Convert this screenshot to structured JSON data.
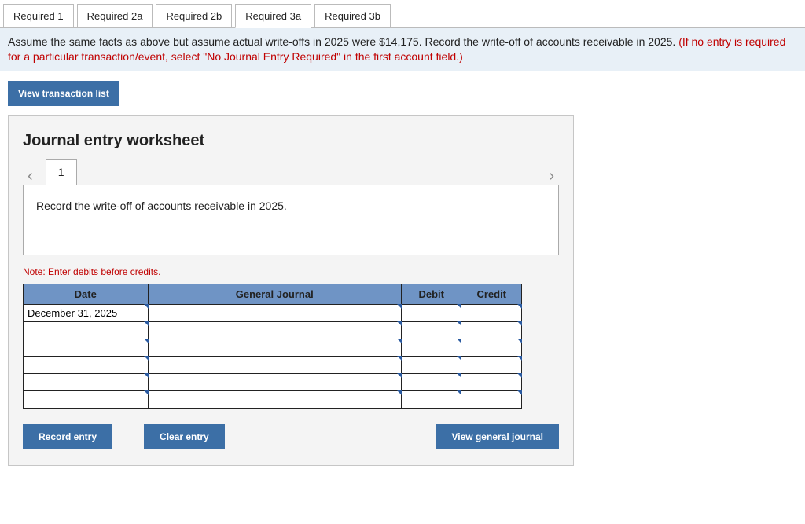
{
  "tabs": {
    "items": [
      {
        "label": "Required 1"
      },
      {
        "label": "Required 2a"
      },
      {
        "label": "Required 2b"
      },
      {
        "label": "Required 3a"
      },
      {
        "label": "Required 3b"
      }
    ],
    "activeIndex": 3
  },
  "instruction": {
    "main": "Assume the same facts as above but assume actual write-offs in 2025 were $14,175. Record the write-off of accounts receivable in 2025. ",
    "hint": "(If no entry is required for a particular transaction/event, select \"No Journal Entry Required\" in the first account field.)"
  },
  "buttons": {
    "view_transactions": "View transaction list",
    "record_entry": "Record entry",
    "clear_entry": "Clear entry",
    "view_general_journal": "View general journal"
  },
  "worksheet": {
    "title": "Journal entry worksheet",
    "page_number": "1",
    "prompt": "Record the write-off of accounts receivable in 2025.",
    "note": "Note: Enter debits before credits.",
    "headers": {
      "date": "Date",
      "gj": "General Journal",
      "debit": "Debit",
      "credit": "Credit"
    },
    "rows": [
      {
        "date": "December 31, 2025",
        "gj": "",
        "debit": "",
        "credit": ""
      },
      {
        "date": "",
        "gj": "",
        "debit": "",
        "credit": ""
      },
      {
        "date": "",
        "gj": "",
        "debit": "",
        "credit": ""
      },
      {
        "date": "",
        "gj": "",
        "debit": "",
        "credit": ""
      },
      {
        "date": "",
        "gj": "",
        "debit": "",
        "credit": ""
      },
      {
        "date": "",
        "gj": "",
        "debit": "",
        "credit": ""
      }
    ]
  }
}
